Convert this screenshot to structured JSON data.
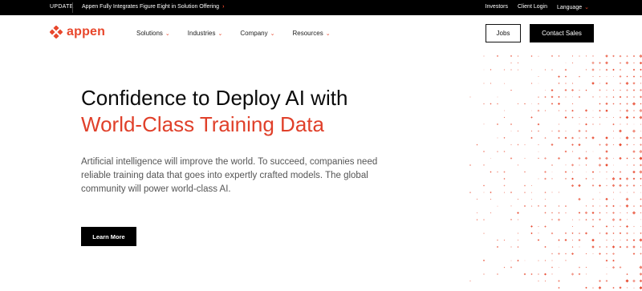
{
  "topbar": {
    "tag": "UPDATE",
    "announcement": "Appen Fully Integrates Figure Eight in Solution Offering",
    "arrow": "›",
    "links": {
      "investors": "Investors",
      "client_login": "Client Login",
      "language": "Language"
    }
  },
  "nav": {
    "logo_text": "appen",
    "menu": {
      "solutions": "Solutions",
      "industries": "Industries",
      "company": "Company",
      "resources": "Resources"
    },
    "jobs": "Jobs",
    "contact": "Contact Sales"
  },
  "hero": {
    "title_line1": "Confidence to Deploy AI with",
    "title_line2": "World-Class Training Data",
    "description": "Artificial intelligence will improve the world. To succeed, companies need reliable training data that goes into expertly crafted models. The global community will power world-class AI.",
    "cta": "Learn More"
  },
  "colors": {
    "accent": "#e8472c",
    "dark": "#000000"
  },
  "icons": {
    "logo": "appen-logo-icon",
    "dropdown": "chevron-down-icon",
    "announce_arrow": "chevron-right-icon"
  }
}
